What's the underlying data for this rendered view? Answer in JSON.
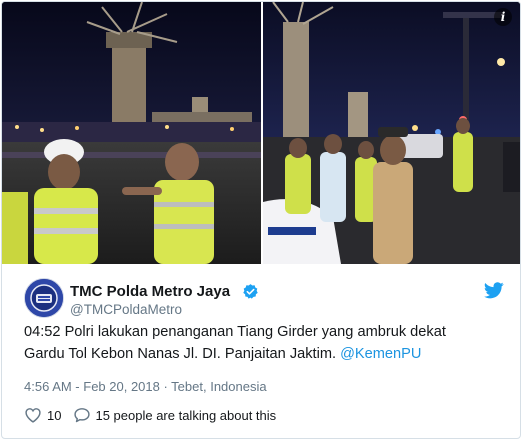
{
  "tweet": {
    "author_name": "TMC Polda Metro Jaya",
    "handle": "@TMCPoldaMetro",
    "verified": true,
    "text_line1": "04:52 Polri lakukan penanganan Tiang Girder yang ambruk dekat",
    "text_line2_prefix": "Gardu Tol Kebon Nanas Jl. DI. Panjaitan Jaktim. ",
    "mention": "@KemenPU",
    "meta": "4:56 AM - Feb 20, 2018 · Tebet, Indonesia",
    "like_count": "10",
    "talking": "15 people are talking about this"
  },
  "media": {
    "info_glyph": "i",
    "photos": [
      {
        "name": "photo-left",
        "icon": "photo"
      },
      {
        "name": "photo-right",
        "icon": "photo"
      }
    ]
  },
  "colors": {
    "link": "#1c94e0",
    "text": "#14171a",
    "muted": "#657786",
    "verified": "#1da1f2",
    "border": "#d6dfe6"
  },
  "icons": {
    "verified": "verified-badge-icon",
    "bird": "twitter-bird-icon",
    "like": "heart-icon",
    "reply": "speech-bubble-icon",
    "info": "info-icon"
  }
}
